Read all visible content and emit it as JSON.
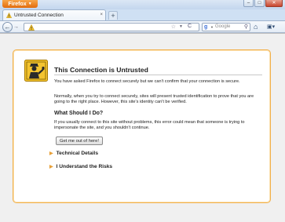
{
  "window": {
    "app_button_label": "Firefox",
    "tab_title": "Untrusted Connection",
    "new_tab_label": "+",
    "controls": {
      "minimize": "–",
      "maximize": "□",
      "close": "✕"
    },
    "tab_close": "×"
  },
  "navbar": {
    "url_value": "",
    "search_engine": "Google",
    "search_placeholder": "Google",
    "back_glyph": "←",
    "forward_glyph": "→",
    "star_glyph": "☆",
    "reload_glyph": "C",
    "search_go_glyph": "⚲",
    "home_glyph": "⌂",
    "bookmarks_glyph": "▣▾"
  },
  "error_page": {
    "title": "This Connection is Untrusted",
    "intro": "You have asked Firefox to connect securely but we can't confirm that your connection is secure.",
    "explanation": "Normally, when you try to connect securely, sites will present trusted identification to prove that you are going to the right place. However, this site's identity can't be verified.",
    "what_should_i_do": "What Should I Do?",
    "advice": "If you usually connect to this site without problems, this error could mean that someone is trying to impersonate the site, and you shouldn't continue.",
    "get_out_button": "Get me out of here!",
    "technical_details": "Technical Details",
    "understand_risks": "I Understand the Risks"
  },
  "colors": {
    "accent_orange": "#f2b04a",
    "firefox_button": "#e26c0c",
    "warning_yellow": "#f4c430"
  },
  "icons": [
    "firefox-menu-icon",
    "warning-icon",
    "star-icon",
    "reload-icon",
    "google-icon",
    "search-go-icon",
    "home-icon",
    "bookmarks-icon",
    "policeman-warning-icon"
  ]
}
